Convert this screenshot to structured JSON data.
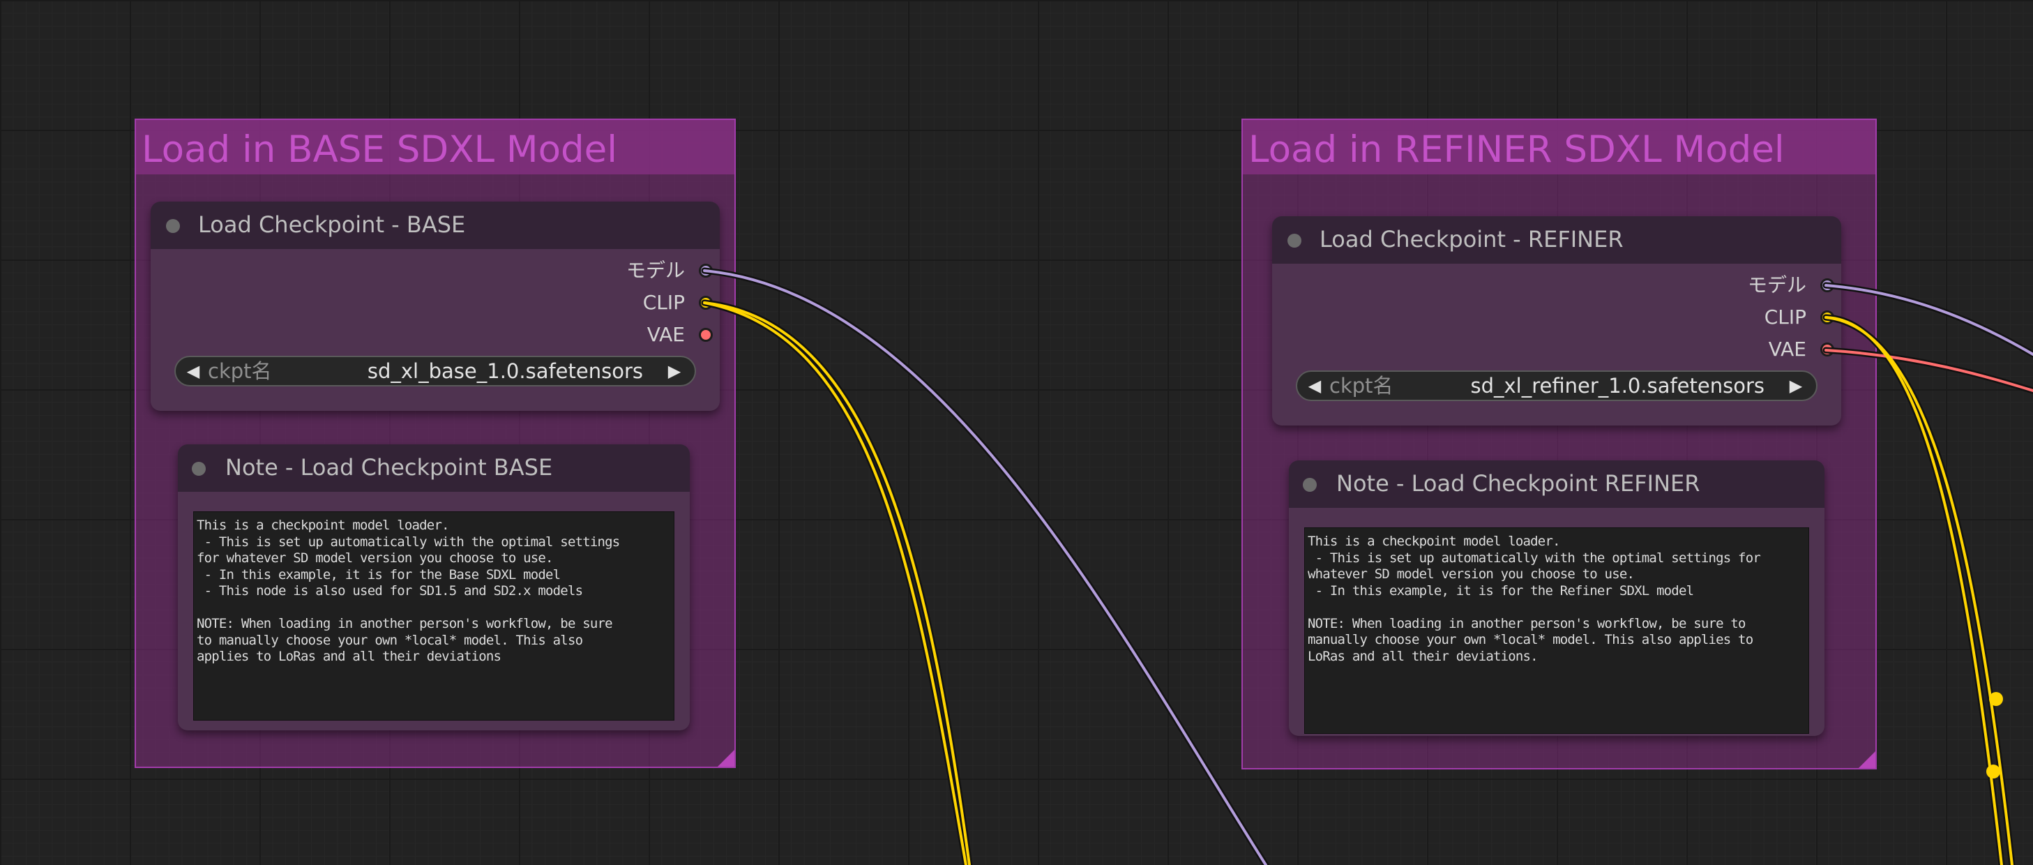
{
  "groups": [
    {
      "title": "Load in BASE SDXL Model",
      "checkpoint": {
        "title": "Load Checkpoint - BASE",
        "outputs": [
          {
            "label": "モデル",
            "color": "#b39ddb"
          },
          {
            "label": "CLIP",
            "color": "#ffd500"
          },
          {
            "label": "VAE",
            "color": "#ff6e6e"
          }
        ],
        "combo": {
          "label": "ckpt名",
          "value": "sd_xl_base_1.0.safetensors",
          "left_arrow": "◀",
          "right_arrow": "▶"
        }
      },
      "note": {
        "title": "Note - Load Checkpoint BASE",
        "text": "This is a checkpoint model loader.\n - This is set up automatically with the optimal settings\nfor whatever SD model version you choose to use.\n - In this example, it is for the Base SDXL model\n - This node is also used for SD1.5 and SD2.x models\n\nNOTE: When loading in another person's workflow, be sure\nto manually choose your own *local* model. This also\napplies to LoRas and all their deviations"
      }
    },
    {
      "title": "Load in REFINER SDXL Model",
      "checkpoint": {
        "title": "Load Checkpoint - REFINER",
        "outputs": [
          {
            "label": "モデル",
            "color": "#b39ddb"
          },
          {
            "label": "CLIP",
            "color": "#ffd500"
          },
          {
            "label": "VAE",
            "color": "#ff6e6e"
          }
        ],
        "combo": {
          "label": "ckpt名",
          "value": "sd_xl_refiner_1.0.safetensors",
          "left_arrow": "◀",
          "right_arrow": "▶"
        }
      },
      "note": {
        "title": "Note - Load Checkpoint REFINER",
        "text": "This is a checkpoint model loader.\n - This is set up automatically with the optimal settings for\nwhatever SD model version you choose to use.\n - In this example, it is for the Refiner SDXL model\n\nNOTE: When loading in another person's workflow, be sure to\nmanually choose your own *local* model. This also applies to\nLoRas and all their deviations."
      }
    }
  ],
  "wire_colors": {
    "model": "#b39ddb",
    "clip": "#ffd500",
    "vae": "#ff6e6e"
  }
}
